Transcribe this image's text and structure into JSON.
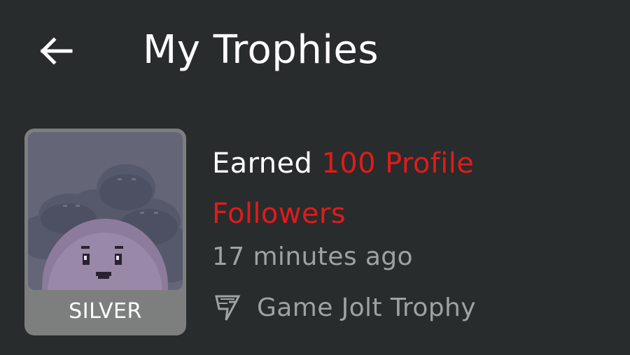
{
  "header": {
    "back_icon": "arrow-left-icon",
    "title": "My Trophies"
  },
  "trophy": {
    "tier": "SILVER",
    "title_prefix": "Earned",
    "title_highlight_line1": "100 Profile",
    "title_highlight_line2": "Followers",
    "time_ago": "17 minutes ago",
    "source_icon": "game-jolt-icon",
    "source": "Game Jolt Trophy"
  },
  "colors": {
    "background": "#282c2c",
    "highlight": "#e01b1b",
    "muted_text": "#9fa2a2",
    "thumb_frame": "#7d7f7f"
  }
}
